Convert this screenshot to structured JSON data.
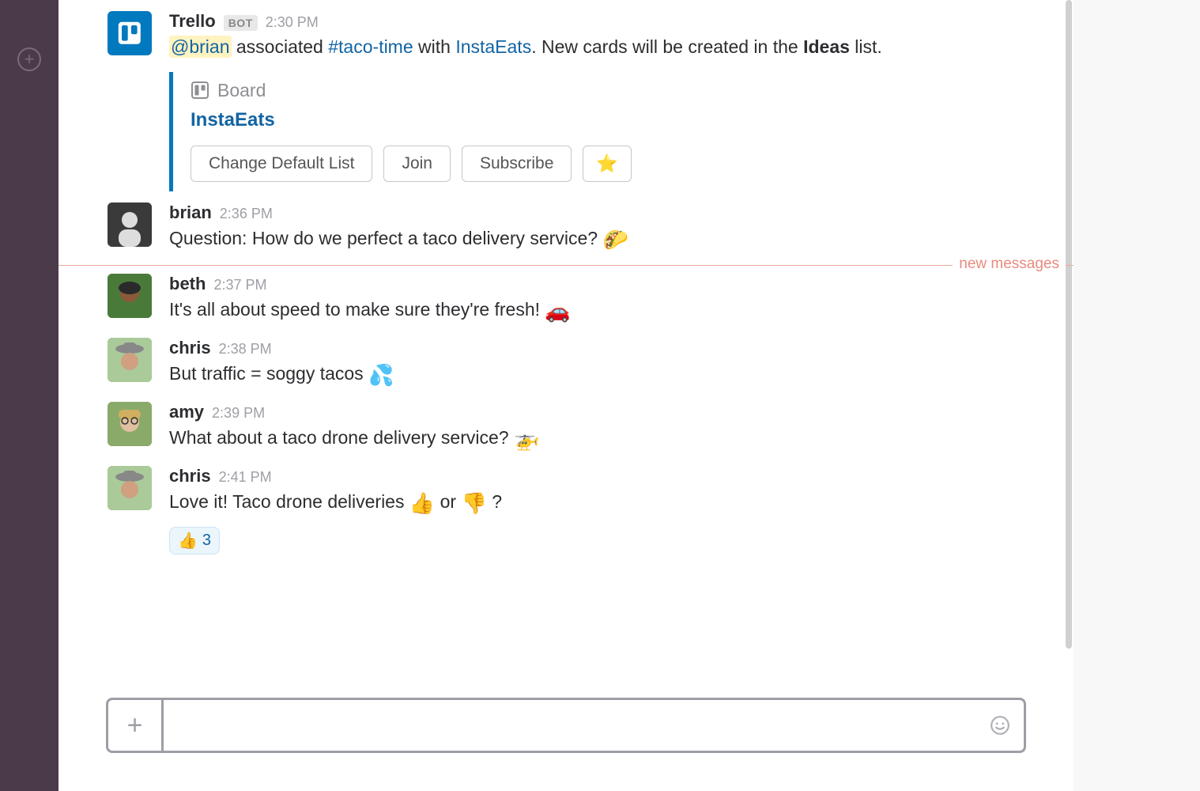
{
  "sidebar": {
    "add_label": "+"
  },
  "trello_msg": {
    "author": "Trello",
    "bot": "BOT",
    "time": "2:30 PM",
    "mention": "@brian",
    "t1": " associated ",
    "channel": "#taco-time",
    "t2": " with ",
    "link": "InstaEats",
    "t3": ". New cards will be created in the ",
    "bold": "Ideas",
    "t4": " list."
  },
  "attachment": {
    "kind": "Board",
    "title": "InstaEats",
    "buttons": {
      "change": "Change Default List",
      "join": "Join",
      "subscribe": "Subscribe",
      "star": "⭐"
    }
  },
  "messages": [
    {
      "author": "brian",
      "time": "2:36 PM",
      "text": "Question: How do we perfect a taco delivery service? ",
      "emoji": "🌮"
    },
    {
      "author": "beth",
      "time": "2:37 PM",
      "text": "It's all about speed to make sure they're fresh! ",
      "emoji": "🚗"
    },
    {
      "author": "chris",
      "time": "2:38 PM",
      "text": "But traffic = soggy tacos ",
      "emoji": "💦"
    },
    {
      "author": "amy",
      "time": "2:39 PM",
      "text": "What about a taco drone delivery service? ",
      "emoji": "🚁"
    }
  ],
  "last_msg": {
    "author": "chris",
    "time": "2:41 PM",
    "t1": "Love it! Taco drone deliveries ",
    "e1": "👍",
    "t2": "  or ",
    "e2": "👎",
    "t3": "  ?"
  },
  "reaction": {
    "emoji": "👍",
    "count": "3"
  },
  "divider": "new messages",
  "composer": {
    "placeholder": ""
  }
}
